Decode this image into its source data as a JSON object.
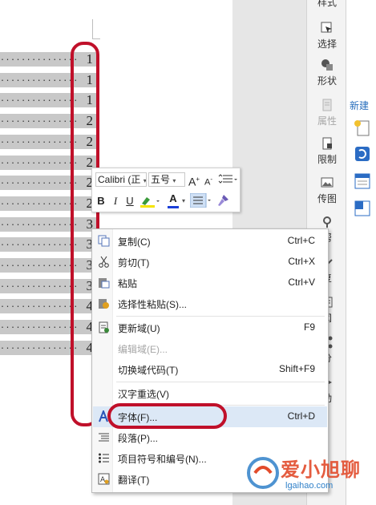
{
  "toc": {
    "page_numbers": [
      "1",
      "1",
      "1",
      "2",
      "2",
      "2",
      "2",
      "2",
      "3",
      "3",
      "3",
      "3",
      "4",
      "4",
      "4"
    ]
  },
  "taskpane": {
    "items": [
      {
        "label": "样式",
        "icon": "style-icon"
      },
      {
        "label": "选择",
        "icon": "select-icon"
      },
      {
        "label": "形状",
        "icon": "shape-icon"
      },
      {
        "label": "属性",
        "icon": "properties-icon",
        "disabled": true
      },
      {
        "label": "限制",
        "icon": "restrict-icon"
      },
      {
        "label": "传图",
        "icon": "upload-image-icon"
      },
      {
        "label": "帮",
        "icon": "help-icon"
      },
      {
        "label": "复",
        "icon": "review-icon"
      },
      {
        "label": "闻",
        "icon": "news-icon"
      },
      {
        "label": "分",
        "icon": "share-icon"
      },
      {
        "label": "动",
        "icon": "animation-icon"
      }
    ],
    "new_label": "新建"
  },
  "mini_toolbar": {
    "font_name": "Calibri (正",
    "font_size": "五号",
    "grow_font": "A",
    "shrink_font": "A",
    "bold": "B",
    "italic": "I",
    "underline": "U",
    "font_color": "A"
  },
  "context_menu": {
    "items": [
      {
        "label": "复制(C)",
        "shortcut": "Ctrl+C",
        "icon": "copy-icon"
      },
      {
        "label": "剪切(T)",
        "shortcut": "Ctrl+X",
        "icon": "cut-icon"
      },
      {
        "label": "粘贴",
        "shortcut": "Ctrl+V",
        "icon": "paste-icon"
      },
      {
        "label": "选择性粘贴(S)...",
        "shortcut": "",
        "icon": "paste-special-icon"
      },
      {
        "label": "更新域(U)",
        "shortcut": "F9",
        "icon": "update-field-icon"
      },
      {
        "label": "编辑域(E)...",
        "shortcut": "",
        "icon": "",
        "disabled": true
      },
      {
        "label": "切换域代码(T)",
        "shortcut": "Shift+F9",
        "icon": ""
      },
      {
        "label": "汉字重选(V)",
        "shortcut": "",
        "icon": ""
      },
      {
        "label": "字体(F)...",
        "shortcut": "Ctrl+D",
        "icon": "font-icon"
      },
      {
        "label": "段落(P)...",
        "shortcut": "",
        "icon": "paragraph-icon"
      },
      {
        "label": "项目符号和编号(N)...",
        "shortcut": "",
        "icon": "bullets-icon"
      },
      {
        "label": "翻译(T)",
        "shortcut": "",
        "icon": "translate-icon"
      }
    ]
  },
  "watermark": {
    "title": "爱小旭聊",
    "url": "lgaihao.com"
  },
  "colors": {
    "annotation_red": "#c0102a",
    "menu_hover": "#dce8f6",
    "selection_grey": "#c8c8c8"
  }
}
